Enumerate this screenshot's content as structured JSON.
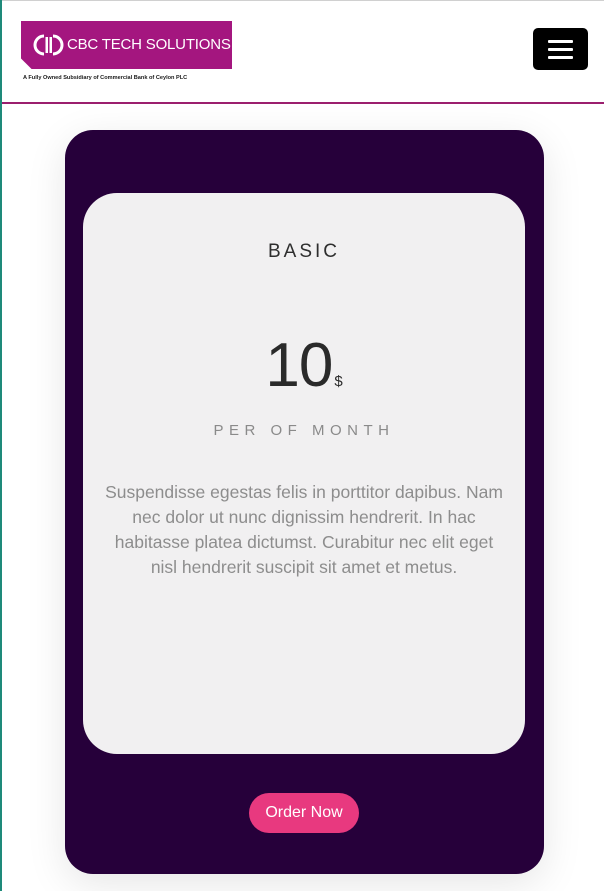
{
  "header": {
    "logo_text": "CBC TECH SOLUTIONS",
    "logo_tagline": "A Fully Owned Subsidiary of Commercial Bank of Ceylon PLC",
    "menu_icon": "hamburger-menu-icon"
  },
  "pricing": {
    "plan_name": "BASIC",
    "price": "10",
    "currency": "$",
    "period": "PER OF MONTH",
    "description": "Suspendisse egestas felis in porttitor dapibus. Nam nec dolor ut nunc dignissim hendrerit. In hac habitasse platea dictumst. Curabitur nec elit eget nisl hendrerit suscipit sit amet et metus.",
    "order_label": "Order Now"
  },
  "colors": {
    "brand": "#a4167f",
    "card_background": "#26003a",
    "inner_card": "#f1f0f1",
    "accent_button": "#e8397f",
    "header_border": "#9b1f6e"
  }
}
